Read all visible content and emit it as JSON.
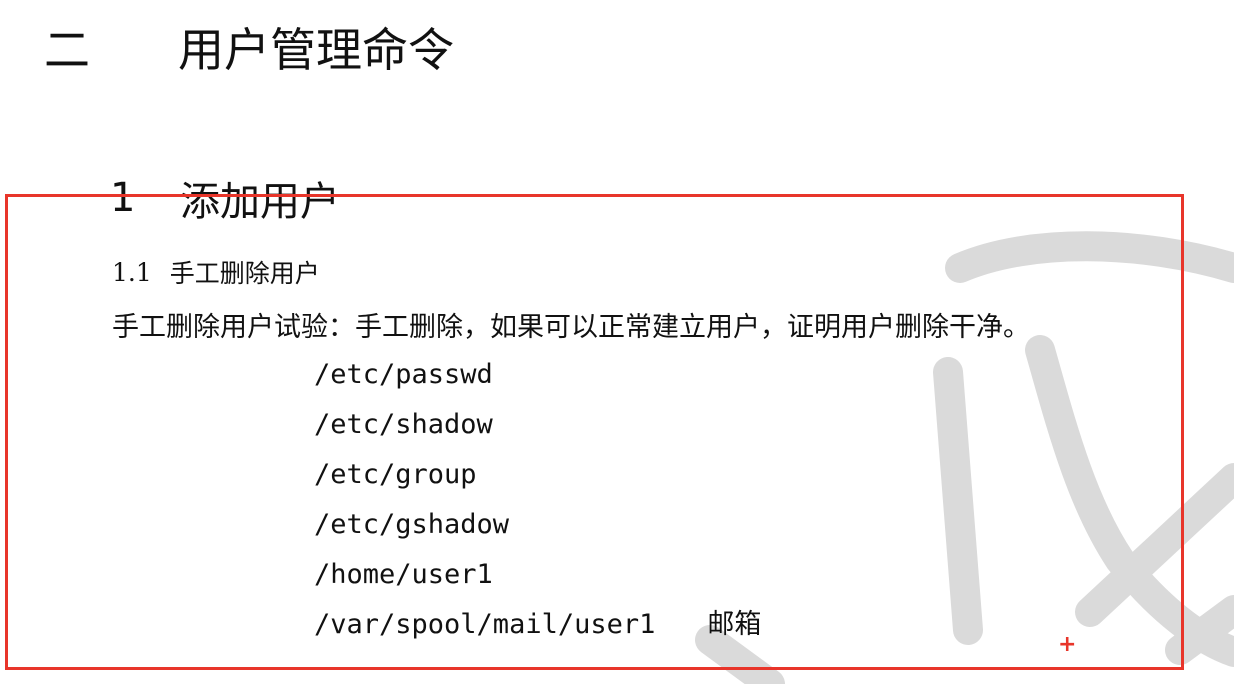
{
  "section": {
    "number": "二",
    "title": "用户管理命令"
  },
  "subsection": {
    "number": "1",
    "title": "添加用户"
  },
  "subsubsection": {
    "number": "1.1",
    "title": "手工删除用户"
  },
  "paragraph": "手工删除用户试验：手工删除，如果可以正常建立用户，证明用户删除干净。",
  "files": [
    {
      "path": "/etc/passwd"
    },
    {
      "path": "/etc/shadow"
    },
    {
      "path": "/etc/group"
    },
    {
      "path": "/etc/gshadow"
    },
    {
      "path": "/home/user1"
    },
    {
      "path": "/var/spool/mail/user1",
      "note": "邮箱"
    }
  ],
  "colors": {
    "highlight": "#e8352a",
    "watermark": "#d9d9d9"
  },
  "icons": {
    "cursor": "crosshair-cursor-icon"
  }
}
